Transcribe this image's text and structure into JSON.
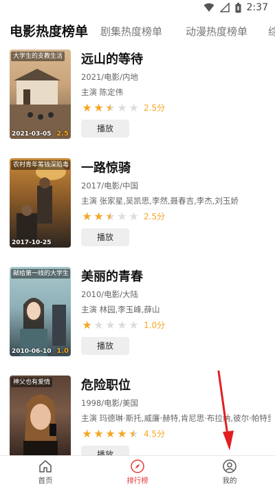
{
  "status_bar": {
    "time": "2:37"
  },
  "tabs": [
    {
      "label": "电影热度榜单",
      "active": true
    },
    {
      "label": "剧集热度榜单",
      "active": false
    },
    {
      "label": "动漫热度榜单",
      "active": false
    },
    {
      "label": "综",
      "active": false
    }
  ],
  "movies": [
    {
      "title": "远山的等待",
      "meta": "2021/电影/内地",
      "cast": "主演 陈定伟",
      "rating": 2.5,
      "score_text": "2.5分",
      "button": "播放",
      "poster_tag": "大学生的支教生活",
      "poster_date": "2021-03-05",
      "poster_score": "2.5",
      "poster_colors": [
        "#c9a37a",
        "#6a5a48"
      ]
    },
    {
      "title": "一路惊骑",
      "meta": "2017/电影/中国",
      "cast": "主演 张家星,吴凯思,李然,聂春吉,李杰,刘玉娇",
      "rating": 2.5,
      "score_text": "2.5分",
      "button": "播放",
      "poster_tag": "农村青年筹钱深陷毒",
      "poster_date": "2017-10-25",
      "poster_score": "",
      "poster_colors": [
        "#b87a2e",
        "#2b2520"
      ]
    },
    {
      "title": "美丽的青春",
      "meta": "2010/电影/大陆",
      "cast": "主演 林园,李玉峰,薛山",
      "rating": 1.0,
      "score_text": "1.0分",
      "button": "播放",
      "poster_tag": "献给第一线的大学生",
      "poster_date": "2010-06-10",
      "poster_score": "1.0",
      "poster_colors": [
        "#8fb0b8",
        "#3a4a50"
      ]
    },
    {
      "title": "危险职位",
      "meta": "1998/电影/美国",
      "cast": "主演 玛德琳·斯托,威廉·赫特,肯尼思·布拉纳,彼尔·帕特里...",
      "rating": 4.5,
      "score_text": "4.5分",
      "button": "播放",
      "poster_tag": "神父也有爱情",
      "poster_date": "",
      "poster_score": "",
      "poster_colors": [
        "#7a5a48",
        "#2a1e18"
      ]
    }
  ],
  "bottom_nav": [
    {
      "label": "首页",
      "icon": "home-icon",
      "active": false
    },
    {
      "label": "排行榜",
      "icon": "compass-icon",
      "active": true
    },
    {
      "label": "我的",
      "icon": "user-icon",
      "active": false
    }
  ],
  "colors": {
    "accent": "#e53935",
    "star": "#f5a623",
    "arrow": "#e02020"
  }
}
